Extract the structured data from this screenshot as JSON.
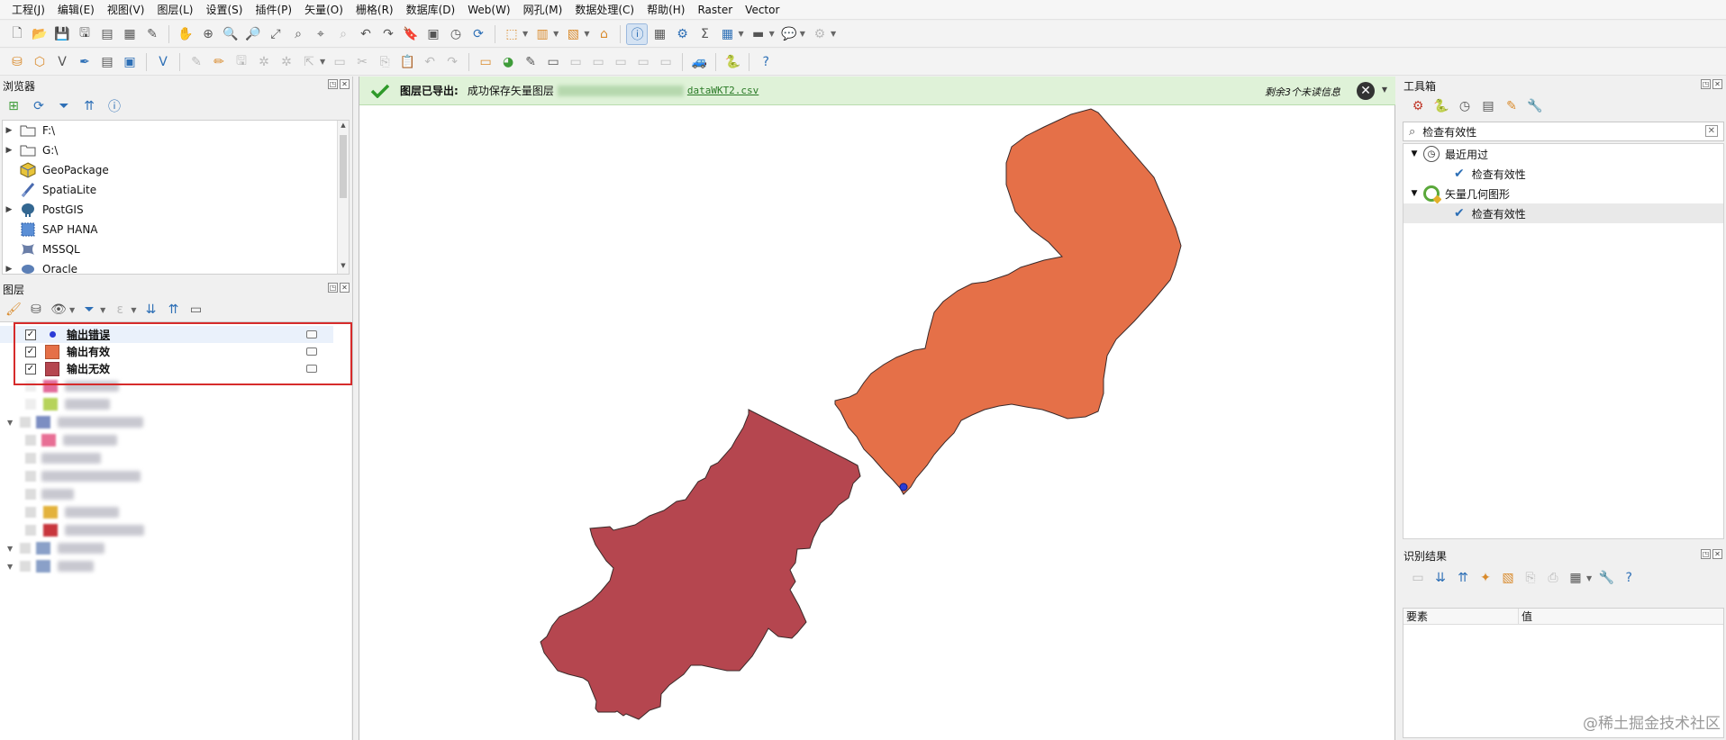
{
  "menu": [
    "工程(J)",
    "编辑(E)",
    "视图(V)",
    "图层(L)",
    "设置(S)",
    "插件(P)",
    "矢量(O)",
    "栅格(R)",
    "数据库(D)",
    "Web(W)",
    "网孔(M)",
    "数据处理(C)",
    "帮助(H)",
    "Raster",
    "Vector"
  ],
  "browser_panel": {
    "title": "浏览器",
    "items": [
      {
        "label": "F:\\",
        "icon": "folder-icon",
        "expandable": true
      },
      {
        "label": "G:\\",
        "icon": "folder-icon",
        "expandable": true
      },
      {
        "label": "GeoPackage",
        "icon": "geopackage-icon",
        "expandable": false
      },
      {
        "label": "SpatiaLite",
        "icon": "spatialite-icon",
        "expandable": false
      },
      {
        "label": "PostGIS",
        "icon": "postgis-elephant-icon",
        "expandable": true
      },
      {
        "label": "SAP HANA",
        "icon": "sap-hana-icon",
        "expandable": false
      },
      {
        "label": "MSSQL",
        "icon": "mssql-icon",
        "expandable": false
      },
      {
        "label": "Oracle",
        "icon": "oracle-icon",
        "expandable": true
      }
    ]
  },
  "layers_panel": {
    "title": "图层",
    "layers": [
      {
        "name": "输出错误",
        "checked": true,
        "symbol": "point",
        "color": "#2b3bd6"
      },
      {
        "name": "输出有效",
        "checked": true,
        "symbol": "fill",
        "color": "#e57048"
      },
      {
        "name": "输出无效",
        "checked": true,
        "symbol": "fill",
        "color": "#b5464f"
      }
    ]
  },
  "message_bar": {
    "title": "图层已导出:",
    "text": "成功保存矢量图层",
    "link": "dataWKT2.csv",
    "remaining": "剩余3个未读信息"
  },
  "toolbox": {
    "title": "工具箱",
    "search_value": "检查有效性",
    "groups": [
      {
        "label": "最近用过",
        "icon": "clock-icon",
        "children": [
          "检查有效性"
        ]
      },
      {
        "label": "矢量几何图形",
        "icon": "qgis-logo-icon",
        "children": [
          "检查有效性"
        ]
      }
    ]
  },
  "identify": {
    "title": "识别结果",
    "columns": [
      "要素",
      "值"
    ]
  },
  "map": {
    "valid_color": "#e57048",
    "invalid_color": "#b5464f",
    "error_color": "#2b3bd6"
  },
  "watermark": "@稀土掘金技术社区"
}
